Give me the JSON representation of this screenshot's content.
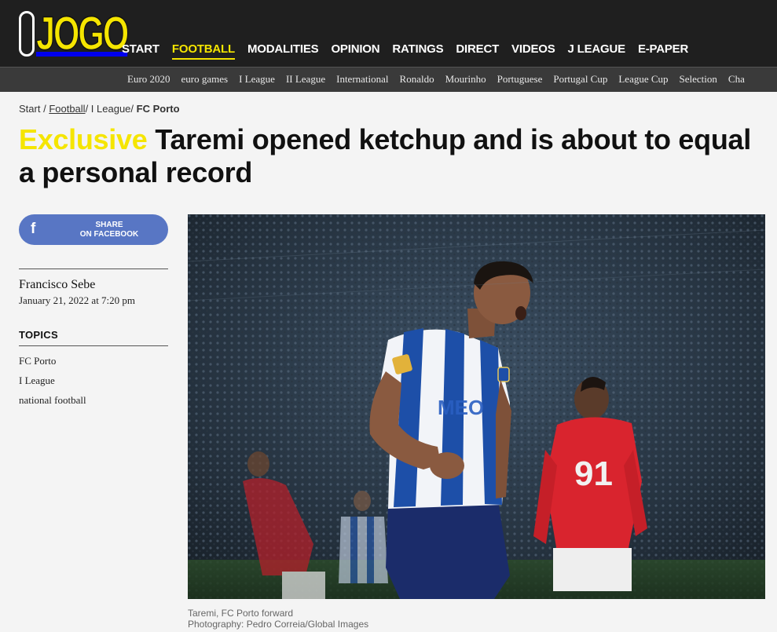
{
  "header": {
    "logo": {
      "letter_o": "O",
      "word": "JOGO"
    },
    "nav": [
      {
        "label": "START",
        "active": false
      },
      {
        "label": "FOOTBALL",
        "active": true
      },
      {
        "label": "MODALITIES",
        "active": false
      },
      {
        "label": "OPINION",
        "active": false
      },
      {
        "label": "RATINGS",
        "active": false
      },
      {
        "label": "DIRECT",
        "active": false
      },
      {
        "label": "VIDEOS",
        "active": false
      },
      {
        "label": "J LEAGUE",
        "active": false
      },
      {
        "label": "E-PAPER",
        "active": false
      }
    ],
    "subnav": [
      "Euro 2020",
      "euro games",
      "I League",
      "II League",
      "International",
      "Ronaldo",
      "Mourinho",
      "Portuguese",
      "Portugal Cup",
      "League Cup",
      "Selection",
      "Cha"
    ]
  },
  "breadcrumb": {
    "start": "Start",
    "football": "Football",
    "league": "I League",
    "current": "FC Porto"
  },
  "article": {
    "tag": "Exclusive",
    "title": "Taremi opened ketchup and is about to equal a personal record",
    "share": {
      "line1": "SHARE",
      "line2": "ON FACEBOOK",
      "icon": "facebook-icon",
      "icon_glyph": "f"
    },
    "author": "Francisco Sebe",
    "date": "January 21, 2022 at 7:20 pm",
    "topics_heading": "TOPICS",
    "topics": [
      "FC Porto",
      "I League",
      "national football"
    ],
    "photo": {
      "jersey_number": "91",
      "caption_line1": "Taremi, FC Porto forward",
      "caption_line2": "Photography: Pedro Correia/Global Images"
    }
  },
  "colors": {
    "brand_yellow": "#f5e500",
    "header_bg": "#1f1f1f",
    "subnav_bg": "#3a3a3a",
    "facebook_blue": "#5876c4",
    "porto_blue": "#1d4fa8",
    "benfica_red": "#d9242e"
  }
}
